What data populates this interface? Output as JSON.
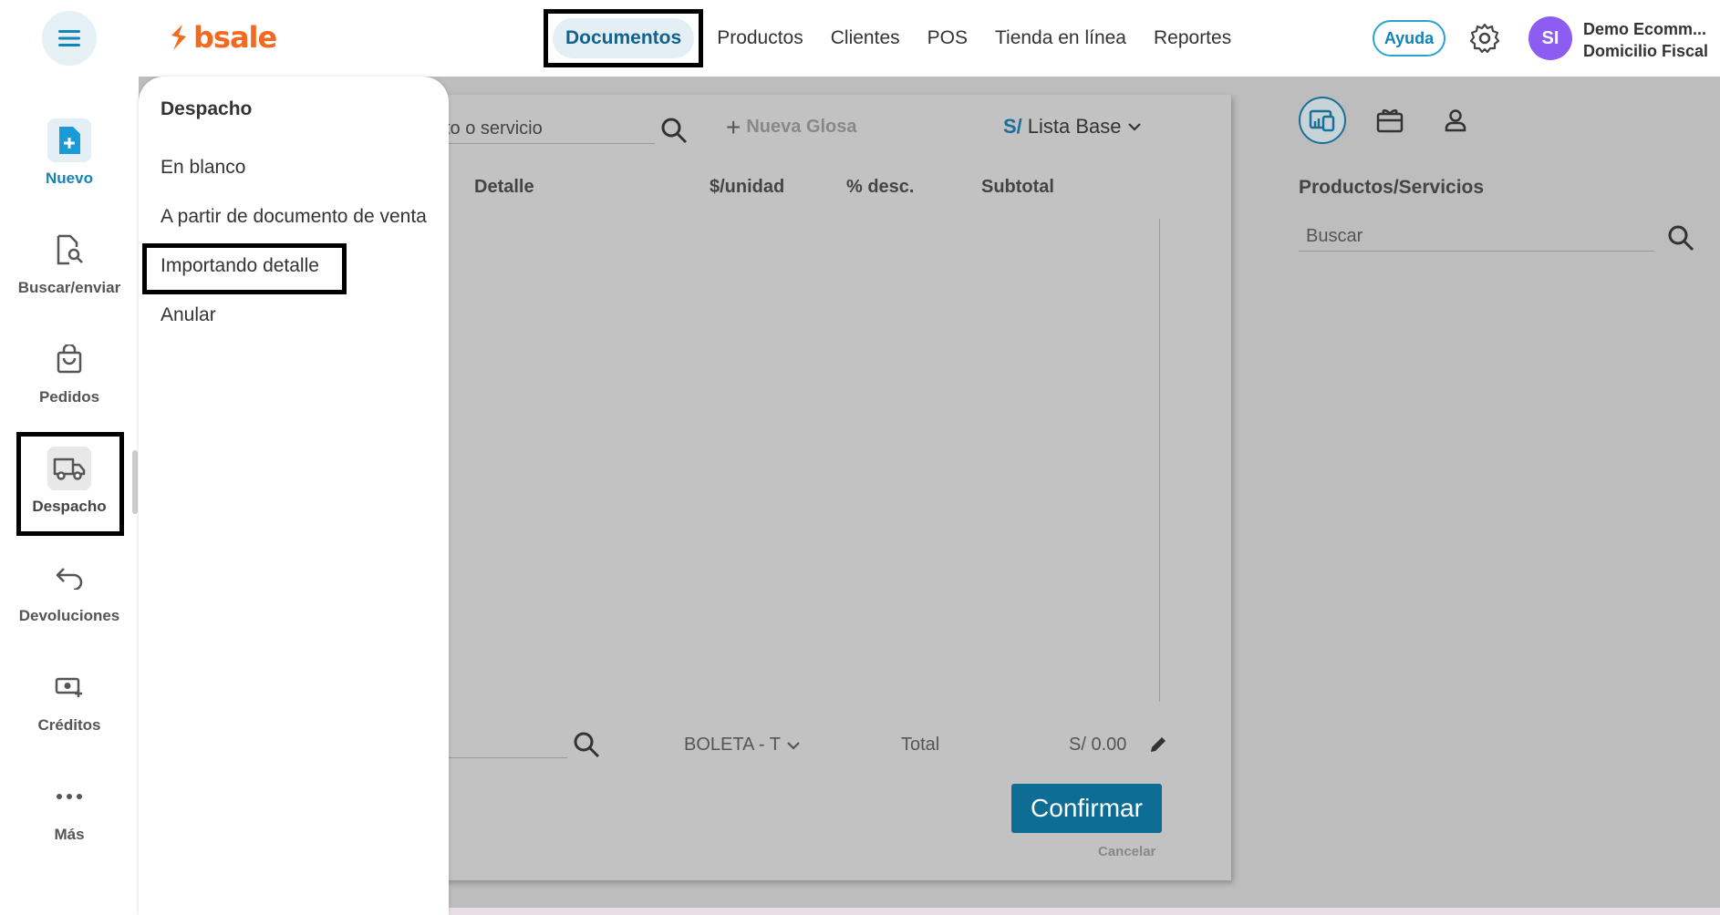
{
  "header": {
    "logo_text": "bsale",
    "nav": [
      "Documentos",
      "Productos",
      "Clientes",
      "POS",
      "Tienda en línea",
      "Reportes"
    ],
    "help_label": "Ayuda",
    "user_initials": "SI",
    "user_name": "Demo Ecomm...",
    "user_subtitle": "Domicilio Fiscal"
  },
  "sidebar": {
    "items": [
      {
        "label": "Nuevo",
        "icon": "new-document-icon"
      },
      {
        "label": "Buscar/enviar",
        "icon": "document-search-icon"
      },
      {
        "label": "Pedidos",
        "icon": "shopping-bag-icon"
      },
      {
        "label": "Despacho",
        "icon": "truck-icon"
      },
      {
        "label": "Devoluciones",
        "icon": "return-arrow-icon"
      },
      {
        "label": "Créditos",
        "icon": "money-plus-icon"
      },
      {
        "label": "Más",
        "icon": "more-dots-icon"
      }
    ]
  },
  "menu": {
    "title": "Despacho",
    "items": [
      "En blanco",
      "A partir de documento de venta",
      "Importando detalle",
      "Anular"
    ]
  },
  "document": {
    "search_visible_text": "to o servicio",
    "new_glosa_label": "Nueva Glosa",
    "price_list_currency": "S/",
    "price_list_label": "Lista Base",
    "columns": [
      "Detalle",
      "$/unidad",
      "% desc.",
      "Subtotal"
    ],
    "doc_type": "BOLETA - T",
    "total_label": "Total",
    "total_value": "S/ 0.00",
    "confirm_label": "Confirmar",
    "cancel_label": "Cancelar"
  },
  "right_panel": {
    "title": "Productos/Servicios",
    "search_placeholder": "Buscar"
  },
  "colors": {
    "accent": "#1384b8",
    "brand": "#f26a21",
    "confirm": "#0e6d95",
    "avatar": "#8d5cf0"
  }
}
